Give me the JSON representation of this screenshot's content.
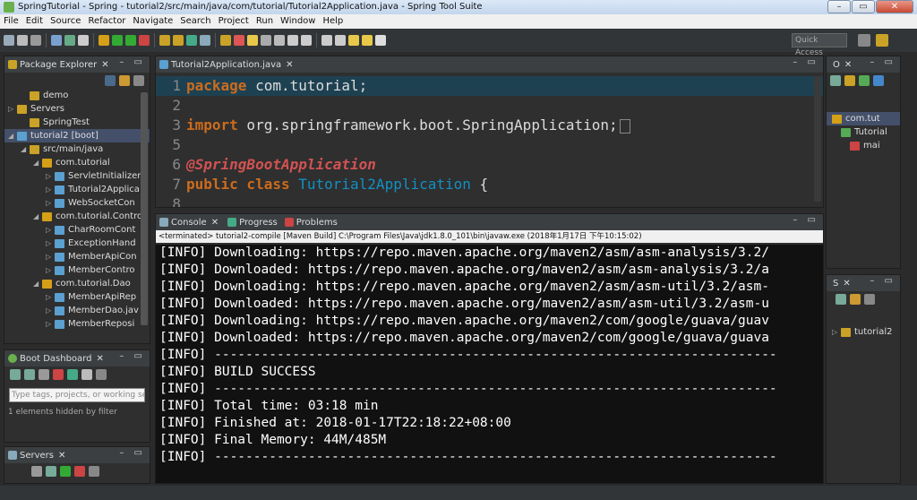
{
  "window": {
    "title": "SpringTutorial - Spring - tutorial2/src/main/java/com/tutorial/Tutorial2Application.java - Spring Tool Suite"
  },
  "menu": [
    "File",
    "Edit",
    "Source",
    "Refactor",
    "Navigate",
    "Search",
    "Project",
    "Run",
    "Window",
    "Help"
  ],
  "toolbar": {
    "quick_access_placeholder": "Quick Access"
  },
  "package_explorer": {
    "title": "Package Explorer",
    "items": [
      {
        "label": "demo",
        "indent": 1,
        "icon": "folder-icon",
        "arrow": ""
      },
      {
        "label": "Servers",
        "indent": 0,
        "icon": "folder-icon",
        "arrow": "▷"
      },
      {
        "label": "SpringTest",
        "indent": 1,
        "icon": "folder-icon",
        "arrow": ""
      },
      {
        "label": "tutorial2 [boot]",
        "indent": 0,
        "icon": "project-icon",
        "arrow": "◢",
        "selected": true
      },
      {
        "label": "src/main/java",
        "indent": 1,
        "icon": "source-folder-icon",
        "arrow": "◢"
      },
      {
        "label": "com.tutorial",
        "indent": 2,
        "icon": "package-icon",
        "arrow": "◢"
      },
      {
        "label": "ServletInitializer",
        "indent": 3,
        "icon": "java-file-icon",
        "arrow": "▷"
      },
      {
        "label": "Tutorial2Applica",
        "indent": 3,
        "icon": "java-file-icon",
        "arrow": "▷"
      },
      {
        "label": "WebSocketCon",
        "indent": 3,
        "icon": "java-file-icon",
        "arrow": "▷"
      },
      {
        "label": "com.tutorial.Contro",
        "indent": 2,
        "icon": "package-icon",
        "arrow": "◢"
      },
      {
        "label": "CharRoomCont",
        "indent": 3,
        "icon": "java-file-icon",
        "arrow": "▷"
      },
      {
        "label": "ExceptionHand",
        "indent": 3,
        "icon": "java-file-icon",
        "arrow": "▷"
      },
      {
        "label": "MemberApiCon",
        "indent": 3,
        "icon": "java-file-icon",
        "arrow": "▷"
      },
      {
        "label": "MemberContro",
        "indent": 3,
        "icon": "java-file-icon",
        "arrow": "▷"
      },
      {
        "label": "com.tutorial.Dao",
        "indent": 2,
        "icon": "package-icon",
        "arrow": "◢"
      },
      {
        "label": "MemberApiRep",
        "indent": 3,
        "icon": "java-file-icon",
        "arrow": "▷"
      },
      {
        "label": "MemberDao.jav",
        "indent": 3,
        "icon": "java-file-icon",
        "arrow": "▷"
      },
      {
        "label": "MemberReposi",
        "indent": 3,
        "icon": "java-file-icon",
        "arrow": "▷"
      }
    ]
  },
  "boot_dashboard": {
    "title": "Boot Dashboard",
    "search_placeholder": "Type tags, projects, or working set",
    "hidden_note": "1 elements hidden by filter"
  },
  "servers_panel": {
    "title": "Servers"
  },
  "editor": {
    "tab": "Tutorial2Application.java",
    "lines": [
      {
        "n": "1",
        "kind": "package",
        "kw": "package",
        "rest": " com.tutorial;"
      },
      {
        "n": "2",
        "kind": "blank"
      },
      {
        "n": "3",
        "kind": "import",
        "kw": "import",
        "rest": " org.springframework.boot.SpringApplication;"
      },
      {
        "n": "5",
        "kind": "blank"
      },
      {
        "n": "6",
        "kind": "annotation",
        "ann": "@SpringBootApplication"
      },
      {
        "n": "7",
        "kind": "class",
        "kw": "public class",
        "cls": "Tutorial2Application",
        "rest": " {"
      },
      {
        "n": "8",
        "kind": "blank"
      }
    ]
  },
  "console": {
    "tabs": [
      "Console",
      "Progress",
      "Problems"
    ],
    "terminated": "<terminated> tutorial2-compile [Maven Build] C:\\Program Files\\Java\\jdk1.8.0_101\\bin\\javaw.exe (2018年1月17日 下午10:15:02)",
    "lines": [
      "[INFO] Downloading: https://repo.maven.apache.org/maven2/asm/asm-analysis/3.2/",
      "[INFO] Downloaded: https://repo.maven.apache.org/maven2/asm/asm-analysis/3.2/a",
      "[INFO] Downloading: https://repo.maven.apache.org/maven2/asm/asm-util/3.2/asm-",
      "[INFO] Downloaded: https://repo.maven.apache.org/maven2/asm/asm-util/3.2/asm-u",
      "[INFO] Downloading: https://repo.maven.apache.org/maven2/com/google/guava/guav",
      "[INFO] Downloaded: https://repo.maven.apache.org/maven2/com/google/guava/guava",
      "[INFO] ------------------------------------------------------------------------",
      "[INFO] BUILD SUCCESS",
      "[INFO] ------------------------------------------------------------------------",
      "[INFO] Total time: 03:18 min",
      "[INFO] Finished at: 2018-01-17T22:18:22+08:00",
      "[INFO] Final Memory: 44M/485M",
      "[INFO] ------------------------------------------------------------------------"
    ]
  },
  "outline": {
    "tab": "O",
    "items": [
      {
        "label": "com.tut"
      },
      {
        "label": "Tutorial"
      },
      {
        "label": "mai"
      }
    ]
  },
  "right_panel2": {
    "tab": "S",
    "items": [
      {
        "label": "tutorial2"
      }
    ]
  },
  "colors": {
    "keyword": "#cc6c1d",
    "annotation": "#d25252",
    "class_name": "#1290c3",
    "line_highlight": "#1e4152"
  }
}
